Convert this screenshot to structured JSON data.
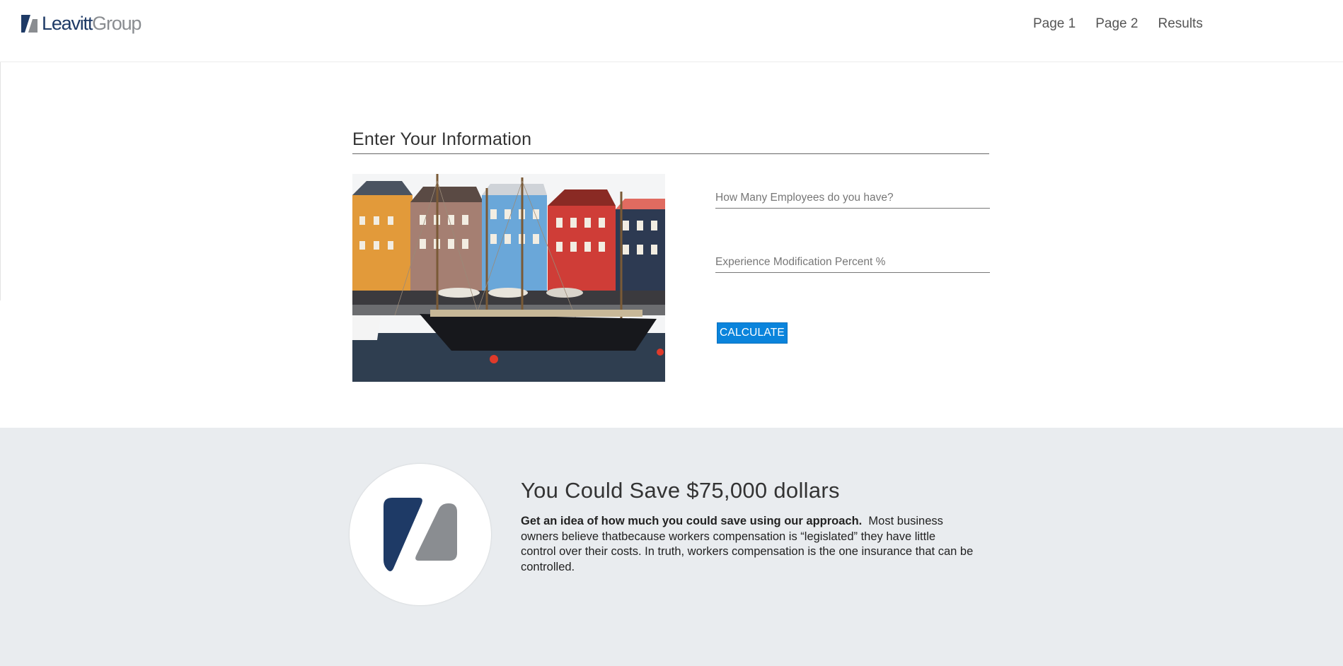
{
  "header": {
    "brand_primary": "Leavitt",
    "brand_secondary": "Group",
    "nav": [
      "Page 1",
      "Page 2",
      "Results"
    ]
  },
  "form": {
    "title": "Enter Your Information",
    "employees_placeholder": "How Many Employees do you have?",
    "employees_value": "",
    "modification_placeholder": "Experience Modification Percent %",
    "modification_value": "",
    "calculate_label": "CALCULATE"
  },
  "savings": {
    "title": "You Could Save $75,000 dollars",
    "lead": "Get an idea of how much you could save using our approach.",
    "body": "Most business owners believe thatbecause workers compensation is “legislated” they have little control over their costs. In truth, workers compensation is the one insurance that can be controlled."
  },
  "colors": {
    "brand_navy": "#1e3a66",
    "brand_gray": "#8a8d91",
    "button_blue": "#0a84dc",
    "section_bg": "#e9ecef"
  },
  "icons": {
    "logo": "leavitt-logo-mark",
    "circle_logo": "leavitt-logo-mark-large"
  }
}
